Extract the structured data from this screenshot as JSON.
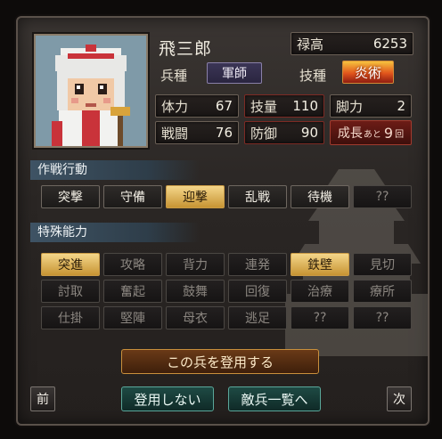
{
  "unit": {
    "name": "飛三郎",
    "stipend_label": "禄高",
    "stipend_value": "6253",
    "troop_label": "兵種",
    "troop_value": "軍師",
    "skill_label": "技種",
    "skill_value": "炎術"
  },
  "stats": [
    {
      "label": "体力",
      "value": "67"
    },
    {
      "label": "技量",
      "value": "110"
    },
    {
      "label": "脚力",
      "value": "2"
    },
    {
      "label": "戦闘",
      "value": "76"
    },
    {
      "label": "防御",
      "value": "90"
    }
  ],
  "growth": {
    "label": "成長",
    "small": "あと",
    "value": "9",
    "unit": "回"
  },
  "tactics": {
    "title": "作戦行動",
    "items": [
      {
        "label": "突撃",
        "state": "enabled"
      },
      {
        "label": "守備",
        "state": "enabled"
      },
      {
        "label": "迎撃",
        "state": "selected"
      },
      {
        "label": "乱戦",
        "state": "enabled"
      },
      {
        "label": "待機",
        "state": "enabled"
      },
      {
        "label": "??",
        "state": "disabled"
      }
    ]
  },
  "abilities": {
    "title": "特殊能力",
    "items": [
      {
        "label": "突進",
        "state": "selected"
      },
      {
        "label": "攻略",
        "state": "disabled"
      },
      {
        "label": "背力",
        "state": "disabled"
      },
      {
        "label": "連発",
        "state": "disabled"
      },
      {
        "label": "鉄壁",
        "state": "selected"
      },
      {
        "label": "見切",
        "state": "disabled"
      },
      {
        "label": "討取",
        "state": "disabled"
      },
      {
        "label": "奮起",
        "state": "disabled"
      },
      {
        "label": "鼓舞",
        "state": "disabled"
      },
      {
        "label": "回復",
        "state": "disabled"
      },
      {
        "label": "治療",
        "state": "disabled"
      },
      {
        "label": "療所",
        "state": "disabled"
      },
      {
        "label": "仕掛",
        "state": "disabled"
      },
      {
        "label": "堅陣",
        "state": "disabled"
      },
      {
        "label": "母衣",
        "state": "disabled"
      },
      {
        "label": "逃足",
        "state": "disabled"
      },
      {
        "label": "??",
        "state": "disabled"
      },
      {
        "label": "??",
        "state": "disabled"
      }
    ]
  },
  "buttons": {
    "recruit": "この兵を登用する",
    "decline": "登用しない",
    "enemy_list": "敵兵一覧へ",
    "prev": "前",
    "next": "次"
  },
  "colors": {
    "accent_gold": "#c79433",
    "growth_red": "#6d1c16",
    "teal": "#1e4a44"
  }
}
